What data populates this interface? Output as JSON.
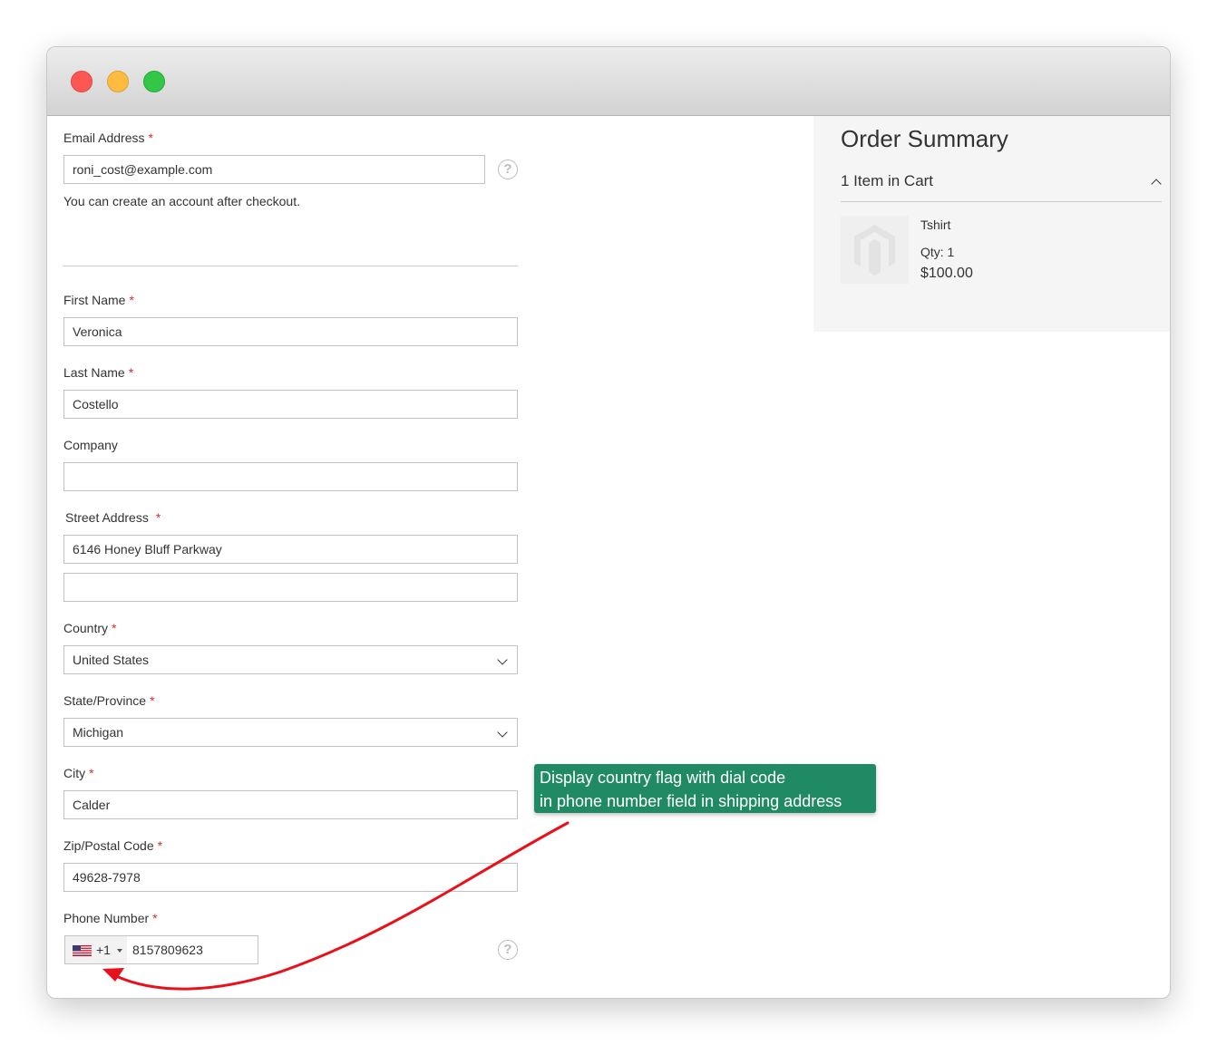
{
  "window": {
    "controls": [
      "close",
      "minimize",
      "maximize"
    ]
  },
  "form": {
    "email": {
      "label": "Email Address",
      "required_mark": "*",
      "value": "roni_cost@example.com",
      "help_icon": "question-circle",
      "note": "You can create an account after checkout."
    },
    "first_name": {
      "label": "First Name",
      "required_mark": "*",
      "value": "Veronica"
    },
    "last_name": {
      "label": "Last Name",
      "required_mark": "*",
      "value": "Costello"
    },
    "company": {
      "label": "Company",
      "value": ""
    },
    "street": {
      "label": "Street Address",
      "required_mark": "*",
      "line1": "6146 Honey Bluff Parkway",
      "line2": ""
    },
    "country": {
      "label": "Country",
      "required_mark": "*",
      "value": "United States"
    },
    "state": {
      "label": "State/Province",
      "required_mark": "*",
      "value": "Michigan"
    },
    "city": {
      "label": "City",
      "required_mark": "*",
      "value": "Calder"
    },
    "zip": {
      "label": "Zip/Postal Code",
      "required_mark": "*",
      "value": "49628-7978"
    },
    "phone": {
      "label": "Phone Number",
      "required_mark": "*",
      "flag_icon": "us-flag",
      "dial_code": "+1",
      "value": "8157809623",
      "help_icon": "question-circle"
    }
  },
  "summary": {
    "title": "Order Summary",
    "cart_count": "1 Item in Cart",
    "item": {
      "name": "Tshirt",
      "qty": "Qty: 1",
      "price": "$100.00",
      "thumb_icon": "magento-logo-placeholder"
    }
  },
  "callout": {
    "line1": "Display country flag with dial code",
    "line2": "in phone number field in shipping address"
  },
  "colors": {
    "required": "#e02b27",
    "callout_bg": "#1f8a64",
    "arrow": "#e8111b",
    "summary_bg": "#f5f5f5"
  }
}
